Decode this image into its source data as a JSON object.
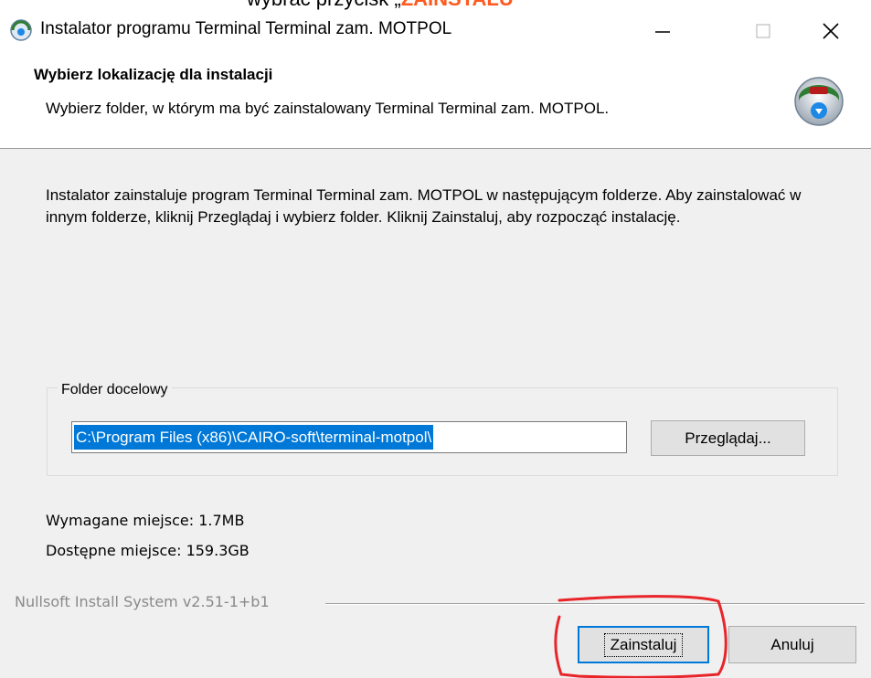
{
  "caption": {
    "prefix": "wybrać przycisk „",
    "highlight": "ZAINSTALU"
  },
  "window": {
    "title": "Instalator programu Terminal Terminal zam. MOTPOL",
    "minimize_glyph": "—",
    "close_glyph": "✕",
    "app_icon": "installer-icon"
  },
  "header": {
    "title": "Wybierz lokalizację dla instalacji",
    "subtitle": "Wybierz folder, w którym ma być zainstalowany Terminal Terminal zam. MOTPOL.",
    "icon": "nsis-installer-icon"
  },
  "content": {
    "description": "Instalator zainstaluje program Terminal Terminal zam. MOTPOL w następującym folderze. Aby zainstalować w innym folderze, kliknij Przeglądaj i wybierz folder. Kliknij Zainstaluj, aby rozpocząć instalację.",
    "destination_group_label": "Folder docelowy",
    "destination_path": "C:\\Program Files (x86)\\CAIRO-soft\\terminal-motpol\\",
    "browse_label": "Przeglądaj...",
    "required_space": "Wymagane miejsce: 1.7MB",
    "available_space": "Dostępne miejsce: 159.3GB"
  },
  "footer": {
    "brand": "Nullsoft Install System v2.51-1+b1",
    "install_label": "Zainstaluj",
    "cancel_label": "Anuluj"
  },
  "colors": {
    "selection": "#0078d7",
    "annotation": "#e8252a",
    "caption_highlight": "#ff5a1f"
  }
}
